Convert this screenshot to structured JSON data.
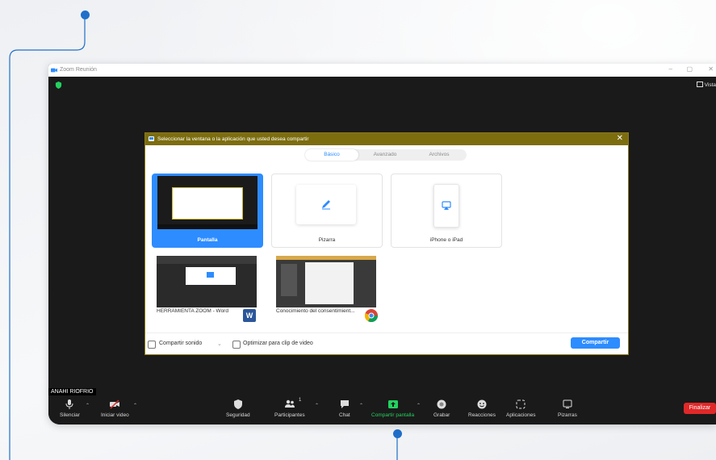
{
  "window": {
    "title": "Zoom Reunión",
    "view_label": "Vista",
    "controls": [
      "–",
      "▢",
      "✕"
    ]
  },
  "dialog": {
    "title": "Seleccionar la ventana o la aplicación que usted desea compartir",
    "close": "✕",
    "tabs": [
      {
        "label": "Básico",
        "active": true
      },
      {
        "label": "Avanzado",
        "active": false
      },
      {
        "label": "Archivos",
        "active": false
      }
    ],
    "tiles": [
      {
        "label": "Pantalla",
        "selected": true
      },
      {
        "label": "Pizarra",
        "selected": false
      },
      {
        "label": "iPhone o iPad",
        "selected": false
      },
      {
        "label": "HERRAMIENTA ZOOM - Word",
        "selected": false
      },
      {
        "label": "Conocimiento del consentimient...",
        "selected": false
      }
    ],
    "footer": {
      "share_sound": "Compartir sonido",
      "optimize_video": "Optimizar para clip de video",
      "share_button": "Compartir"
    }
  },
  "participant_name": "ANAHI RIOFRIO",
  "toolbar": {
    "items": [
      {
        "label": "Silenciar",
        "icon": "microphone-icon"
      },
      {
        "label": "Iniciar video",
        "icon": "video-off-icon"
      },
      {
        "label": "Seguridad",
        "icon": "shield-icon"
      },
      {
        "label": "Participantes",
        "icon": "participants-icon",
        "count": "1"
      },
      {
        "label": "Chat",
        "icon": "chat-icon"
      },
      {
        "label": "Compartir pantalla",
        "icon": "share-screen-icon"
      },
      {
        "label": "Grabar",
        "icon": "record-icon"
      },
      {
        "label": "Reacciones",
        "icon": "reactions-icon"
      },
      {
        "label": "Aplicaciones",
        "icon": "apps-icon"
      },
      {
        "label": "Pizarras",
        "icon": "whiteboard-icon"
      }
    ],
    "end_button": "Finalizar"
  },
  "colors": {
    "accent_blue": "#2d8cff",
    "dialog_header": "#7c6d0f",
    "share_green": "#23d160",
    "end_red": "#e02828",
    "connector_blue": "#1f6fc9"
  }
}
